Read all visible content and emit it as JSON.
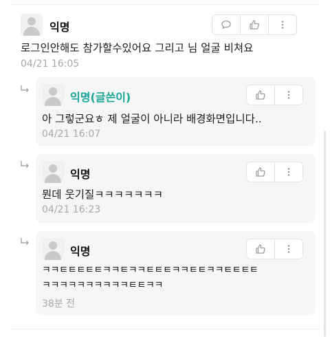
{
  "comments": [
    {
      "author": "익명",
      "text": "로그인안해도 참가할수있어요 그리고 님 얼굴 비쳐요",
      "time": "04/21 16:05"
    }
  ],
  "replies": [
    {
      "author": "익명(글쓴이)",
      "is_writer": true,
      "lines": [
        "아 그렇군요ㅎ 제 얼굴이 아니라 배경화면입니다.."
      ],
      "time": "04/21 16:07"
    },
    {
      "author": "익명",
      "is_writer": false,
      "lines": [
        "뭔데 웃기질ㅋㅋㅋㅋㅋㅋㅋ"
      ],
      "time": "04/21 16:23"
    },
    {
      "author": "익명",
      "is_writer": false,
      "lines": [
        "ㅋㅋㅌㅌㅌㅌㅌㅋㅋㅌㅋㅋㅌㅌㅌㅋㅋㅌㅌㅋㅋㅌㅌㅌㅌ",
        "ㅋㅋㅋㅋㅋㅋㅋㅋㅋㅋㅌㅌㅋㅋ"
      ],
      "time": "38분 전"
    }
  ],
  "icons": {
    "comment": "speech-bubble-icon",
    "like": "thumbs-up-icon",
    "more": "more-vertical-icon",
    "reply": "reply-arrow-icon",
    "avatar": "default-avatar"
  },
  "colors": {
    "writer": "#16a596",
    "time": "#a8a8a8",
    "reply_bg": "#f6f6f6"
  }
}
